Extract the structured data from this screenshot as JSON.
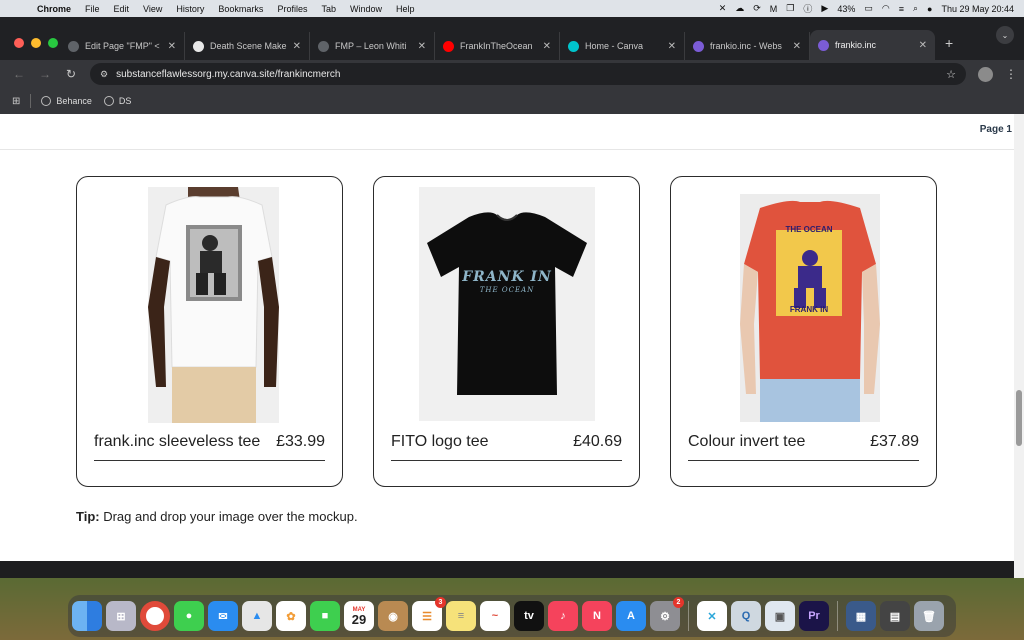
{
  "menubar": {
    "app_name": "Chrome",
    "items": [
      "File",
      "Edit",
      "View",
      "History",
      "Bookmarks",
      "Profiles",
      "Tab",
      "Window",
      "Help"
    ],
    "battery": "43%",
    "datetime": "Thu 29 May  20:44"
  },
  "tabs": [
    {
      "label": "Edit Page \"FMP\" <",
      "color": "#5f6368",
      "icon": "globe-icon"
    },
    {
      "label": "Death Scene Make",
      "color": "#e8e8e8",
      "icon": "chatgpt-icon"
    },
    {
      "label": "FMP – Leon Whiti",
      "color": "#5f6368",
      "icon": "globe-icon"
    },
    {
      "label": "FrankInTheOcean",
      "color": "#ff0000",
      "icon": "youtube-icon"
    },
    {
      "label": "Home - Canva",
      "color": "#00c4cc",
      "icon": "canva-icon"
    },
    {
      "label": "frankio.inc - Webs",
      "color": "#7b5cd6",
      "icon": "canva-site-icon"
    },
    {
      "label": "frankio.inc",
      "color": "#7b5cd6",
      "icon": "canva-site-icon",
      "active": true
    }
  ],
  "address_bar": {
    "url": "substanceflawlessorg.my.canva.site/frankincmerch"
  },
  "bookmarks": [
    {
      "label": "Behance"
    },
    {
      "label": "DS"
    }
  ],
  "page": {
    "page_label": "Page 1",
    "products": [
      {
        "name": "frank.inc sleeveless tee",
        "price": "£33.99"
      },
      {
        "name": "FITO logo tee",
        "price": "£40.69",
        "print_line1": "FRANK IN",
        "print_line2": "THE OCEAN"
      },
      {
        "name": "Colour invert tee",
        "price": "£37.89",
        "print_top": "THE OCEAN",
        "print_bottom": "FRANK IN"
      }
    ],
    "tip_bold": "Tip:",
    "tip_text": " Drag and drop your image over the mockup."
  },
  "dock": {
    "calendar_month": "MAY",
    "calendar_day": "29",
    "reminders_badge": "3",
    "settings_badge": "2"
  },
  "colors": {
    "chrome_bg": "#202124",
    "card_border": "#2c2c2c",
    "orange_tee": "#e0533d"
  }
}
